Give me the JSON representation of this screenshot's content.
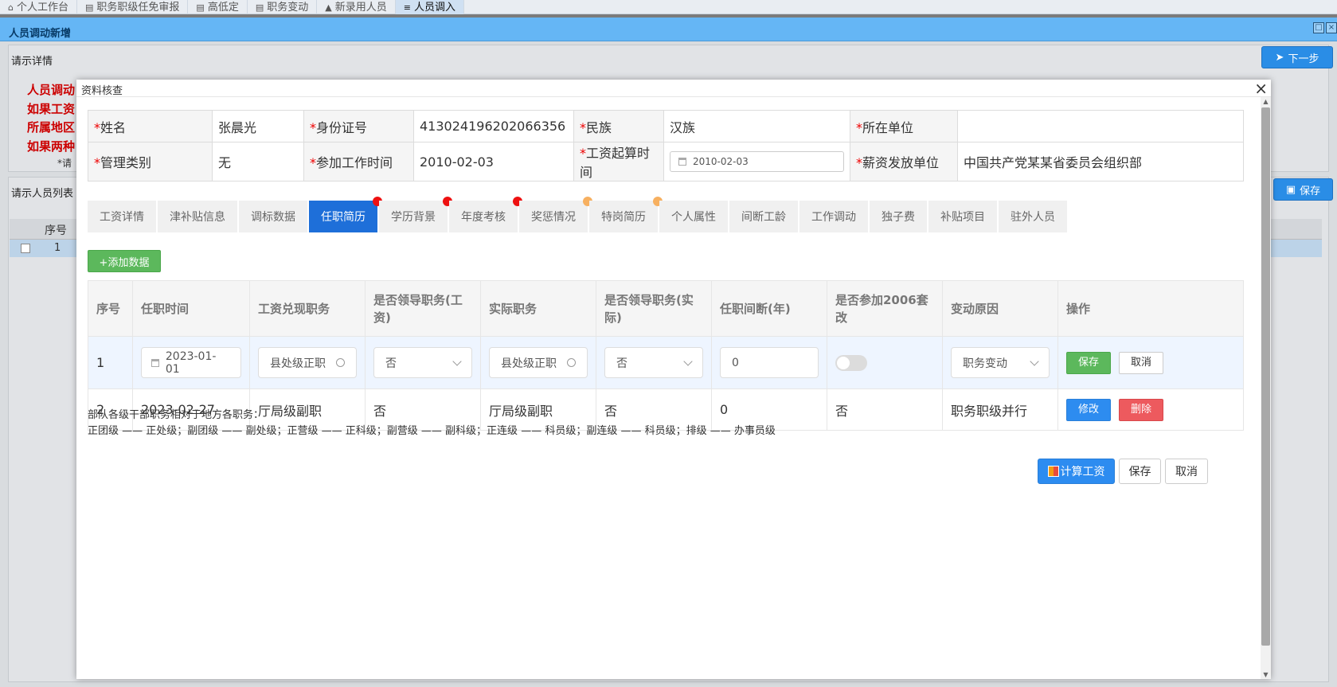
{
  "top_tabs": [
    {
      "label": "个人工作台",
      "icon": "home-icon"
    },
    {
      "label": "职务职级任免审报",
      "icon": "doc-icon"
    },
    {
      "label": "高低定",
      "icon": "doc-icon"
    },
    {
      "label": "职务变动",
      "icon": "doc-icon"
    },
    {
      "label": "新录用人员",
      "icon": "user-icon"
    },
    {
      "label": "人员调入",
      "icon": "list-icon"
    }
  ],
  "main_window": {
    "title": "人员调动新增",
    "section_detail": "请示详情",
    "next_button": "下一步",
    "red_notes": [
      "人员调动",
      "如果工资",
      "所属地区",
      "如果两种"
    ],
    "red_star_label": "*请",
    "section_list": "请示人员列表",
    "save_button": "保存",
    "list_header_seq": "序号",
    "list_row_seq": "1"
  },
  "dialog": {
    "title": "资料核查",
    "close": "×",
    "info": {
      "name_label": "姓名",
      "name_value": "张晨光",
      "id_label": "身份证号",
      "id_value": "413024196202066356",
      "ethnic_label": "民族",
      "ethnic_value": "汉族",
      "unit_label": "所在单位",
      "unit_value": "",
      "mgmt_label": "管理类别",
      "mgmt_value": "无",
      "workstart_label": "参加工作时间",
      "workstart_value": "2010-02-03",
      "salarystart_label": "工资起算时间",
      "salarystart_value": "2010-02-03",
      "payunit_label": "薪资发放单位",
      "payunit_value": "中国共产党某某省委员会组织部"
    },
    "tabs": [
      {
        "label": "工资详情",
        "dot": ""
      },
      {
        "label": "津补贴信息",
        "dot": ""
      },
      {
        "label": "调标数据",
        "dot": ""
      },
      {
        "label": "任职简历",
        "dot": "red",
        "active": true
      },
      {
        "label": "学历背景",
        "dot": "red"
      },
      {
        "label": "年度考核",
        "dot": "red"
      },
      {
        "label": "奖惩情况",
        "dot": "orange"
      },
      {
        "label": "特岗简历",
        "dot": "orange"
      },
      {
        "label": "个人属性",
        "dot": ""
      },
      {
        "label": "间断工龄",
        "dot": ""
      },
      {
        "label": "工作调动",
        "dot": ""
      },
      {
        "label": "独子费",
        "dot": ""
      },
      {
        "label": "补贴项目",
        "dot": ""
      },
      {
        "label": "驻外人员",
        "dot": ""
      }
    ],
    "add_button": "+添加数据",
    "columns": [
      "序号",
      "任职时间",
      "工资兑现职务",
      "是否领导职务(工资)",
      "实际职务",
      "是否领导职务(实际)",
      "任职间断(年)",
      "是否参加2006套改",
      "变动原因",
      "操作"
    ],
    "edit_row": {
      "seq": "1",
      "date": "2023-01-01",
      "salary_post": "县处级正职",
      "leader_salary": "否",
      "actual_post": "县处级正职",
      "leader_actual": "否",
      "gap_years": "0",
      "reform_2006": false,
      "reason": "职务变动",
      "save": "保存",
      "cancel": "取消"
    },
    "rows": [
      {
        "seq": "2",
        "date": "2023-02-27",
        "salary_post": "厅局级副职",
        "leader_salary": "否",
        "actual_post": "厅局级副职",
        "leader_actual": "否",
        "gap_years": "0",
        "reform_2006": "否",
        "reason": "职务职级并行",
        "edit": "修改",
        "delete": "删除"
      }
    ],
    "note_line1": "部队各级干部职务相对于地方各职务：",
    "note_line2": "正团级 —— 正处级；副团级 —— 副处级；正营级 —— 正科级；副营级 —— 副科级；正连级 —— 科员级；副连级 —— 科员级；排级 —— 办事员级",
    "footer": {
      "calc": "计算工资",
      "save": "保存",
      "cancel": "取消"
    }
  },
  "colors": {
    "active_tab": "#1e6fd9",
    "title_bar": "#65b6f5",
    "green": "#5cb85c",
    "blue": "#2d8cf0",
    "red": "#ed5a5e",
    "dot_red": "#ee1111",
    "dot_orange": "#f7b060"
  }
}
